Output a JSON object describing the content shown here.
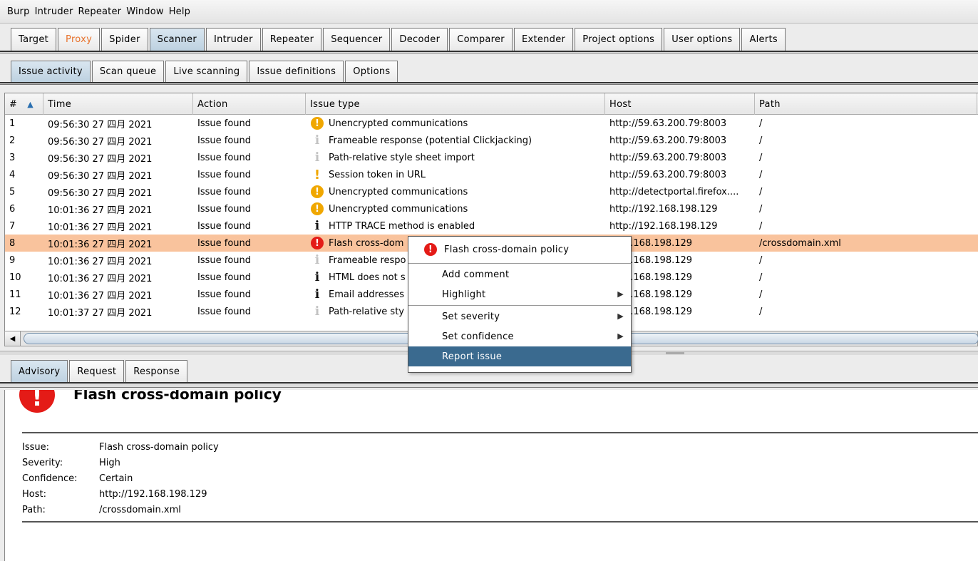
{
  "menubar": [
    "Burp",
    "Intruder",
    "Repeater",
    "Window",
    "Help"
  ],
  "main_tabs": [
    "Target",
    "Proxy",
    "Spider",
    "Scanner",
    "Intruder",
    "Repeater",
    "Sequencer",
    "Decoder",
    "Comparer",
    "Extender",
    "Project options",
    "User options",
    "Alerts"
  ],
  "active_main_tab": "Scanner",
  "sub_tabs": [
    "Issue activity",
    "Scan queue",
    "Live scanning",
    "Issue definitions",
    "Options"
  ],
  "active_sub_tab": "Issue activity",
  "table": {
    "headers": [
      "#",
      "Time",
      "Action",
      "Issue type",
      "Host",
      "Path"
    ],
    "rows": [
      {
        "n": "1",
        "time": "09:56:30 27 四月 2021",
        "action": "Issue found",
        "icon": "medium-severity-icon",
        "issue": "Unencrypted communications",
        "host": "http://59.63.200.79:8003",
        "path": "/"
      },
      {
        "n": "2",
        "time": "09:56:30 27 四月 2021",
        "action": "Issue found",
        "icon": "info-tentative-icon",
        "issue": "Frameable response (potential Clickjacking)",
        "host": "http://59.63.200.79:8003",
        "path": "/"
      },
      {
        "n": "3",
        "time": "09:56:30 27 四月 2021",
        "action": "Issue found",
        "icon": "info-tentative-icon",
        "issue": "Path-relative style sheet import",
        "host": "http://59.63.200.79:8003",
        "path": "/"
      },
      {
        "n": "4",
        "time": "09:56:30 27 四月 2021",
        "action": "Issue found",
        "icon": "low-severity-icon",
        "issue": "Session token in URL",
        "host": "http://59.63.200.79:8003",
        "path": "/"
      },
      {
        "n": "5",
        "time": "09:56:30 27 四月 2021",
        "action": "Issue found",
        "icon": "medium-severity-icon",
        "issue": "Unencrypted communications",
        "host": "http://detectportal.firefox....",
        "path": "/"
      },
      {
        "n": "6",
        "time": "10:01:36 27 四月 2021",
        "action": "Issue found",
        "icon": "medium-severity-icon",
        "issue": "Unencrypted communications",
        "host": "http://192.168.198.129",
        "path": "/"
      },
      {
        "n": "7",
        "time": "10:01:36 27 四月 2021",
        "action": "Issue found",
        "icon": "info-certain-icon",
        "issue": "HTTP TRACE method is enabled",
        "host": "http://192.168.198.129",
        "path": "/"
      },
      {
        "n": "8",
        "time": "10:01:36 27 四月 2021",
        "action": "Issue found",
        "icon": "high-severity-icon",
        "issue": "Flash cross-dom",
        "host": "/192.168.198.129",
        "path": "/crossdomain.xml"
      },
      {
        "n": "9",
        "time": "10:01:36 27 四月 2021",
        "action": "Issue found",
        "icon": "info-tentative-icon",
        "issue": "Frameable respo",
        "host": "/192.168.198.129",
        "path": "/"
      },
      {
        "n": "10",
        "time": "10:01:36 27 四月 2021",
        "action": "Issue found",
        "icon": "info-certain-icon",
        "issue": "HTML does not s",
        "host": "/192.168.198.129",
        "path": "/"
      },
      {
        "n": "11",
        "time": "10:01:36 27 四月 2021",
        "action": "Issue found",
        "icon": "info-certain-icon",
        "issue": "Email addresses",
        "host": "/192.168.198.129",
        "path": "/"
      },
      {
        "n": "12",
        "time": "10:01:37 27 四月 2021",
        "action": "Issue found",
        "icon": "info-tentative-icon",
        "issue": "Path-relative sty",
        "host": "/192.168.198.129",
        "path": "/"
      }
    ],
    "selected_row": 8
  },
  "context_menu": {
    "header": "Flash cross-domain policy",
    "items": [
      "Add comment",
      "Highlight",
      "Set severity",
      "Set confidence",
      "Report issue"
    ],
    "highlighted": "Report issue"
  },
  "bottom_tabs": [
    "Advisory",
    "Request",
    "Response"
  ],
  "active_bottom_tab": "Advisory",
  "advisory": {
    "title": "Flash cross-domain policy",
    "fields": [
      {
        "k": "Issue:",
        "v": "Flash cross-domain policy"
      },
      {
        "k": "Severity:",
        "v": "High"
      },
      {
        "k": "Confidence:",
        "v": "Certain"
      },
      {
        "k": "Host:",
        "v": "http://192.168.198.129"
      },
      {
        "k": "Path:",
        "v": "/crossdomain.xml"
      }
    ]
  },
  "colors": {
    "accent": "#3a6a8f",
    "selected_row": "#f9c39d",
    "high": "#e41b17",
    "medium": "#f0a700",
    "proxy_tab_text": "#e8712a"
  }
}
